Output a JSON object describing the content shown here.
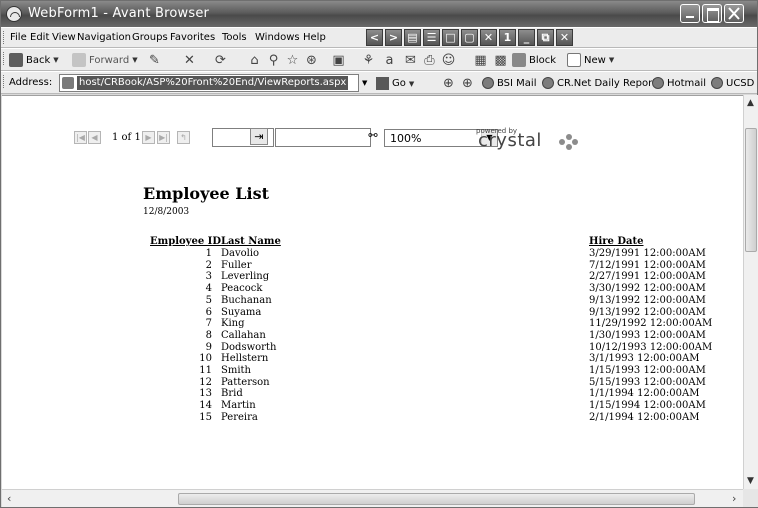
{
  "window": {
    "title": "WebForm1 - Avant Browser"
  },
  "menu": [
    "File",
    "Edit",
    "View",
    "Navigation",
    "Groups",
    "Favorites",
    "Tools",
    "Windows",
    "Help"
  ],
  "menu_icons": [
    "<",
    ">",
    "▤",
    "☰",
    "□",
    "▢",
    "✕",
    "1",
    "_",
    "⧉",
    "✕"
  ],
  "nav": {
    "back": "Back",
    "forward": "Forward",
    "block": "Block",
    "new": "New"
  },
  "address": {
    "label": "Address:",
    "url": "host/CRBook/ASP%20Front%20End/ViewReports.aspx",
    "go": "Go",
    "links": [
      "BSI Mail",
      "CR.Net Daily Report",
      "Hotmail",
      "UCSD"
    ]
  },
  "viewer": {
    "page_info": "1 of 1",
    "zoom": "100%",
    "powered_by": "powered by",
    "brand": "crystal"
  },
  "report": {
    "title": "Employee List",
    "date": "12/8/2003",
    "headers": {
      "id": "Employee ID",
      "last": "Last Name",
      "hire": "Hire Date"
    },
    "rows": [
      {
        "id": "1",
        "last": "Davolio",
        "hire": "3/29/1991  12:00:00AM"
      },
      {
        "id": "2",
        "last": "Fuller",
        "hire": "7/12/1991  12:00:00AM"
      },
      {
        "id": "3",
        "last": "Leverling",
        "hire": "2/27/1991  12:00:00AM"
      },
      {
        "id": "4",
        "last": "Peacock",
        "hire": "3/30/1992  12:00:00AM"
      },
      {
        "id": "5",
        "last": "Buchanan",
        "hire": "9/13/1992  12:00:00AM"
      },
      {
        "id": "6",
        "last": "Suyama",
        "hire": "9/13/1992  12:00:00AM"
      },
      {
        "id": "7",
        "last": "King",
        "hire": "11/29/1992  12:00:00AM"
      },
      {
        "id": "8",
        "last": "Callahan",
        "hire": "1/30/1993  12:00:00AM"
      },
      {
        "id": "9",
        "last": "Dodsworth",
        "hire": "10/12/1993  12:00:00AM"
      },
      {
        "id": "10",
        "last": "Hellstern",
        "hire": "3/1/1993  12:00:00AM"
      },
      {
        "id": "11",
        "last": "Smith",
        "hire": "1/15/1993  12:00:00AM"
      },
      {
        "id": "12",
        "last": "Patterson",
        "hire": "5/15/1993  12:00:00AM"
      },
      {
        "id": "13",
        "last": "Brid",
        "hire": "1/1/1994  12:00:00AM"
      },
      {
        "id": "14",
        "last": "Martin",
        "hire": "1/15/1994  12:00:00AM"
      },
      {
        "id": "15",
        "last": "Pereira",
        "hire": "2/1/1994  12:00:00AM"
      }
    ]
  }
}
